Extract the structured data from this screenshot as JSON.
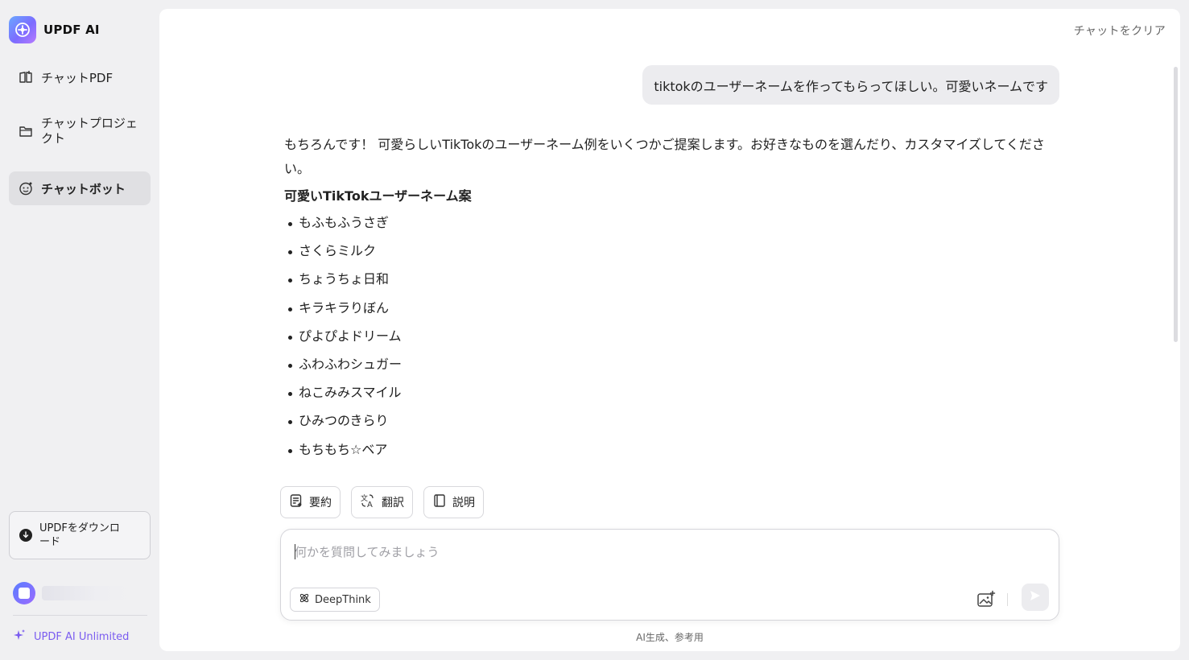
{
  "brand": {
    "name": "UPDF AI"
  },
  "sidebar": {
    "items": [
      {
        "label": "チャットPDF",
        "icon": "book-open-icon"
      },
      {
        "label": "チャットプロジェクト",
        "icon": "folder-icon"
      },
      {
        "label": "チャットボット",
        "icon": "bot-face-icon"
      }
    ],
    "download_label": "UPDFをダウンロード",
    "unlimited_label": "UPDF AI Unlimited"
  },
  "header": {
    "clear_label": "チャットをクリア"
  },
  "conversation": {
    "user_message": "tiktokのユーザーネームを作ってもらってほしい。可愛いネームです",
    "assistant": {
      "intro": "もちろんです！ 可愛らしいTikTokのユーザーネーム例をいくつかご提案します。お好きなものを選んだり、カスタマイズしてください。",
      "heading": "可愛いTikTokユーザーネーム案",
      "items": [
        "もふもふうさぎ",
        "さくらミルク",
        "ちょうちょ日和",
        "キラキラりぼん",
        "ぴよぴよドリーム",
        "ふわふわシュガー",
        "ねこみみスマイル",
        "ひみつのきらり",
        "もちもち☆ベア"
      ]
    }
  },
  "actions": {
    "summarize": "要約",
    "translate": "翻訳",
    "explain": "説明"
  },
  "composer": {
    "placeholder": "何かを質問してみましょう",
    "deepthink_label": "DeepThink"
  },
  "footnote": "AI生成、参考用",
  "colors": {
    "accent": "#7a5cf0",
    "surface": "#ffffff",
    "sidebar_bg": "#f0f0f2"
  }
}
